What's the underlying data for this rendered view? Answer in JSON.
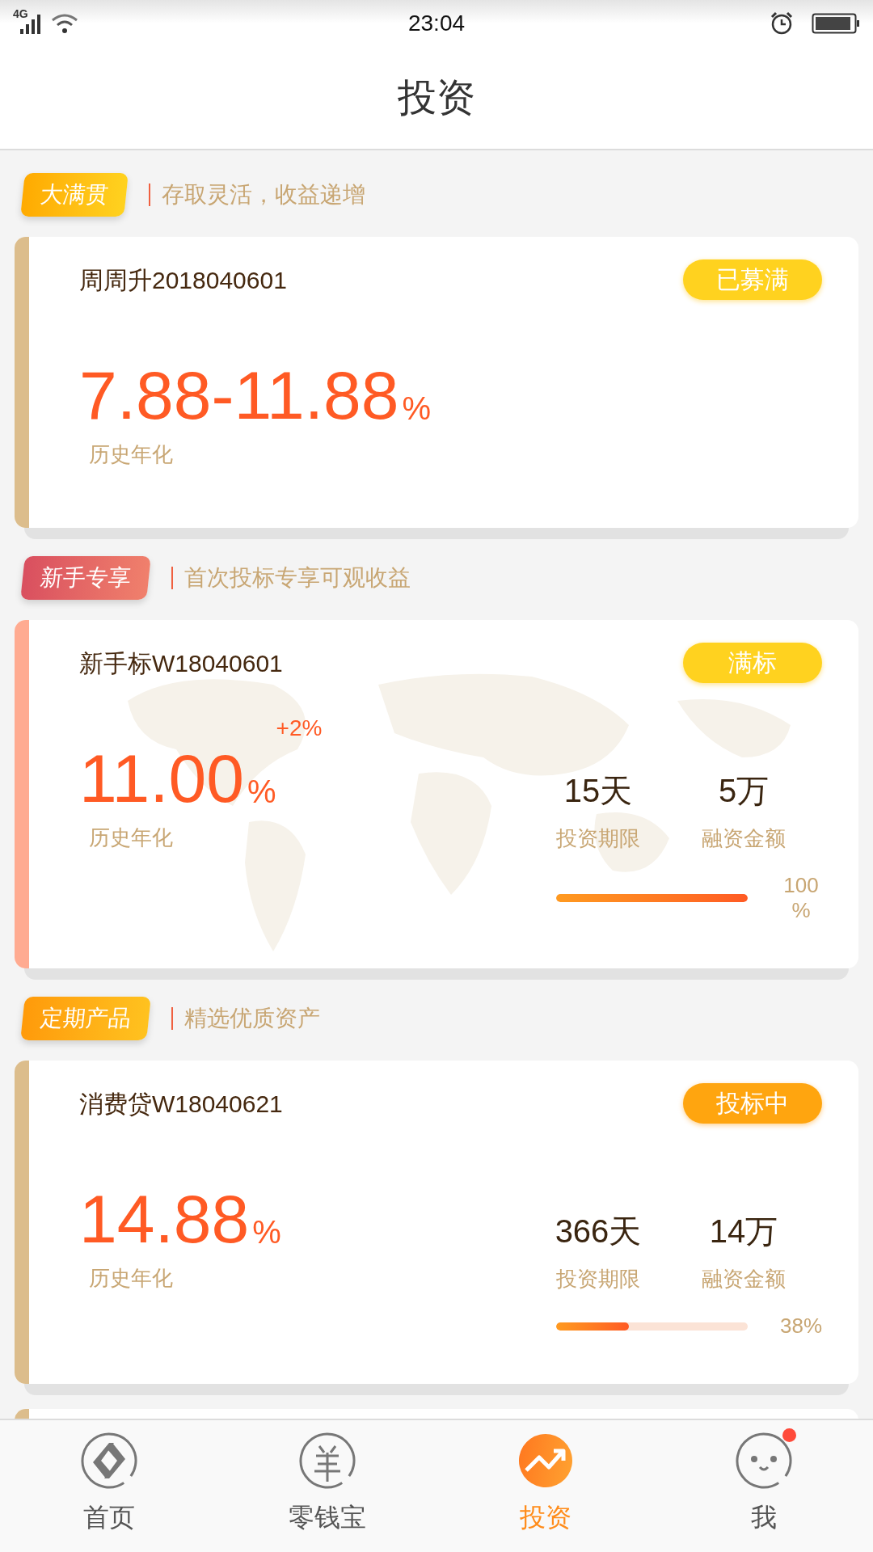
{
  "status_bar": {
    "network": "4G",
    "time": "23:04"
  },
  "header": {
    "title": "投资"
  },
  "sections": [
    {
      "kind": "featured",
      "tag": "大满贯",
      "subtitle": "存取灵活，收益递增",
      "card": {
        "name": "周周升2018040601",
        "status": {
          "label": "已募满",
          "kind": "closed"
        },
        "rate": "7.88-11.88",
        "unit": "%",
        "rate_label": "历史年化"
      }
    },
    {
      "kind": "newbie",
      "tag": "新手专享",
      "subtitle": "首次投标专享可观收益",
      "card": {
        "name": "新手标W18040601",
        "status": {
          "label": "满标",
          "kind": "closed"
        },
        "rate": "11.00",
        "unit": "%",
        "bonus": "+2%",
        "rate_label": "历史年化",
        "stats": [
          {
            "value": "15天",
            "label": "投资期限"
          },
          {
            "value": "5万",
            "label": "融资金额"
          }
        ],
        "progress": {
          "level": 1,
          "reading": "100%"
        }
      }
    },
    {
      "kind": "regular",
      "tag": "定期产品",
      "subtitle": "精选优质资产",
      "card": {
        "name": "消费贷W18040621",
        "status": {
          "label": "投标中",
          "kind": "open"
        },
        "rate": "14.88",
        "unit": "%",
        "rate_label": "历史年化",
        "stats": [
          {
            "value": "366天",
            "label": "投资期限"
          },
          {
            "value": "14万",
            "label": "融资金额"
          }
        ],
        "progress": {
          "level": 0.38,
          "reading": "38%"
        }
      }
    }
  ],
  "nav": [
    {
      "kind": "home",
      "label": "首页",
      "selected": false,
      "dot": false
    },
    {
      "kind": "wallet",
      "label": "零钱宝",
      "selected": false,
      "dot": false
    },
    {
      "kind": "invest",
      "label": "投资",
      "selected": true,
      "dot": false
    },
    {
      "kind": "profile",
      "label": "我",
      "selected": false,
      "dot": true
    }
  ]
}
